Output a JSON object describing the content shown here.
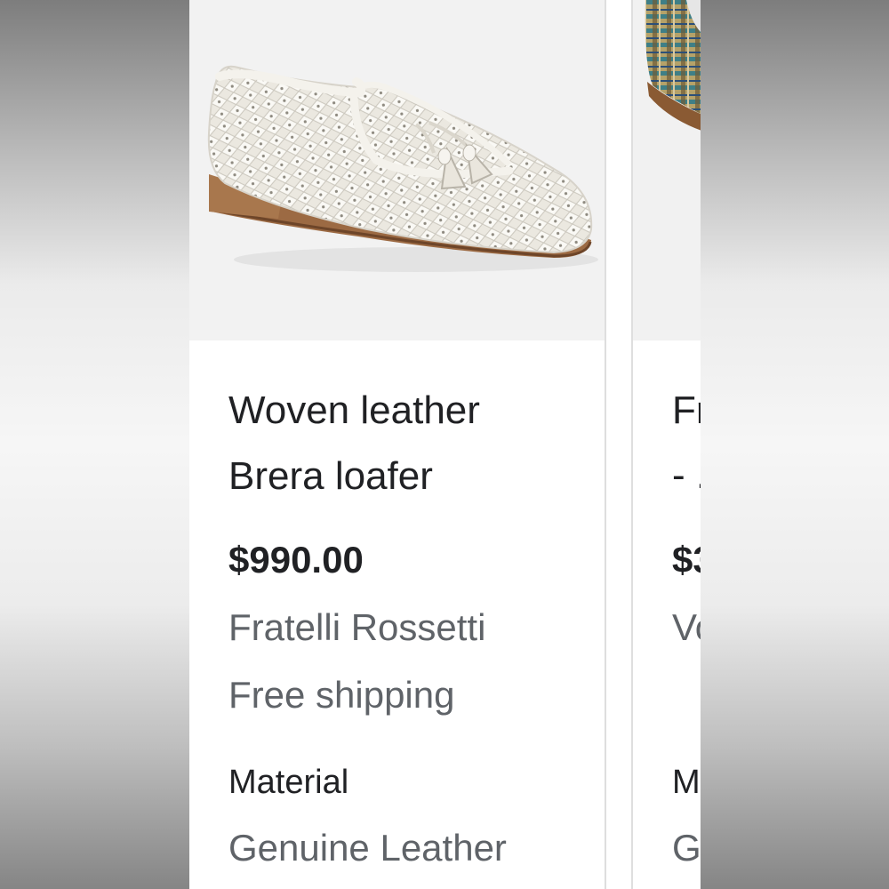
{
  "cards": [
    {
      "title_line1": "Woven leather",
      "title_line2": "Brera loafer",
      "price": "$990.00",
      "seller": "Fratelli Rossetti",
      "shipping": "Free shipping",
      "attribute_label": "Material",
      "attribute_value": "Genuine Leather",
      "image_icon": "white-woven-loafer-image"
    },
    {
      "title_fragment": "Fr",
      "title_line2_fragment": "- .",
      "price_fragment": "$3",
      "seller_fragment": "Vo",
      "attribute_label_fragment": "M",
      "attribute_value_fragment": "G",
      "image_icon": "multicolor-plaid-shoe-image"
    }
  ],
  "colors": {
    "title": "#202124",
    "secondary_text": "#5f6368",
    "card_border": "#dedede",
    "image_background": "#f2f2f2"
  }
}
